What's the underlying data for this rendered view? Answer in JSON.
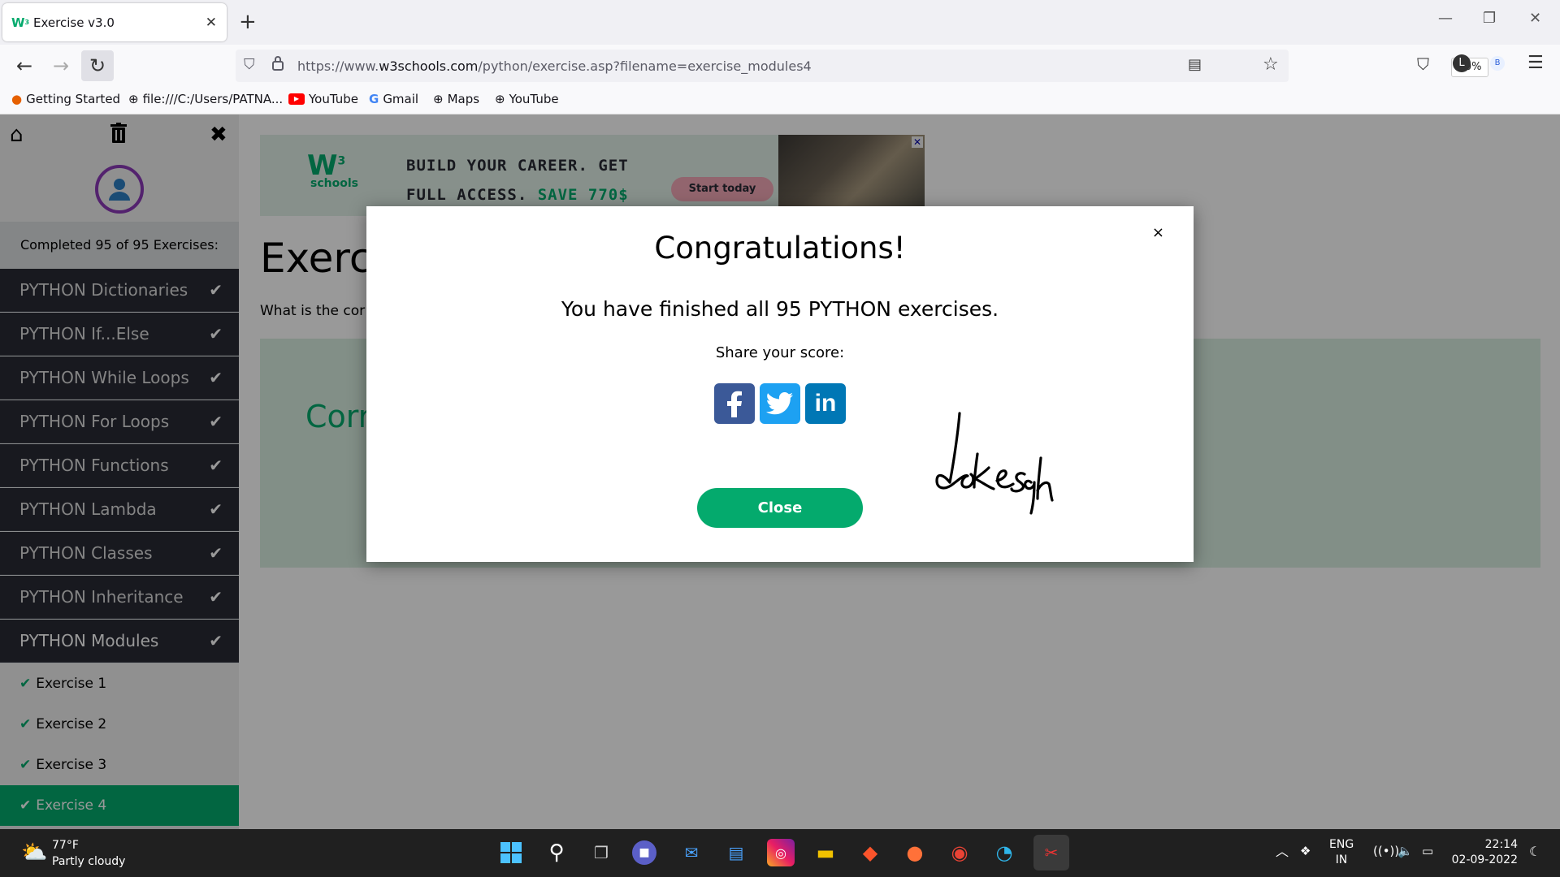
{
  "browser": {
    "tab_title": "Exercise v3.0",
    "tab_close": "✕",
    "new_tab": "+",
    "url_prefix": "https://www.",
    "url_domain": "w3schools.com",
    "url_path": "/python/exercise.asp?filename=exercise_modules4",
    "zoom": "90%",
    "profile_initial": "L",
    "ext_initial": "B"
  },
  "bookmarks": [
    {
      "label": "Getting Started",
      "icon": "firefox-icon"
    },
    {
      "label": "file:///C:/Users/PATNA...",
      "icon": "globe-icon"
    },
    {
      "label": "YouTube",
      "icon": "youtube-icon"
    },
    {
      "label": "Gmail",
      "icon": "google-icon"
    },
    {
      "label": "Maps",
      "icon": "globe-icon"
    },
    {
      "label": "YouTube",
      "icon": "globe-icon"
    }
  ],
  "sidebar": {
    "completed_text": "Completed 95 of 95 Exercises:",
    "categories": [
      "PYTHON Dictionaries",
      "PYTHON If...Else",
      "PYTHON While Loops",
      "PYTHON For Loops",
      "PYTHON Functions",
      "PYTHON Lambda",
      "PYTHON Classes",
      "PYTHON Inheritance",
      "PYTHON Modules"
    ],
    "exercises": [
      "Exercise 1",
      "Exercise 2",
      "Exercise 3",
      "Exercise 4"
    ]
  },
  "ad": {
    "line1": "BUILD YOUR CAREER. GET",
    "line2_a": "FULL ACCESS.",
    "line2_b": "SAVE 770$",
    "button": "Start today",
    "logo_main": "W",
    "logo_sup": "3",
    "logo_sub": "schools"
  },
  "main": {
    "title": "Exercis",
    "question": "What is the cor",
    "correct": "Corr"
  },
  "modal": {
    "title": "Congratulations!",
    "message": "You have finished all 95 PYTHON exercises.",
    "share_label": "Share your score:",
    "close_button": "Close",
    "close_x": "×",
    "signature": "Lokesh"
  },
  "taskbar": {
    "temperature": "77°F",
    "weather": "Partly cloudy",
    "lang": "ENG",
    "region": "IN",
    "time": "22:14",
    "date": "02-09-2022"
  },
  "colors": {
    "accent": "#04aa6d",
    "sidebar_dark": "#282a35",
    "avatar_ring": "#8b3ab8"
  }
}
